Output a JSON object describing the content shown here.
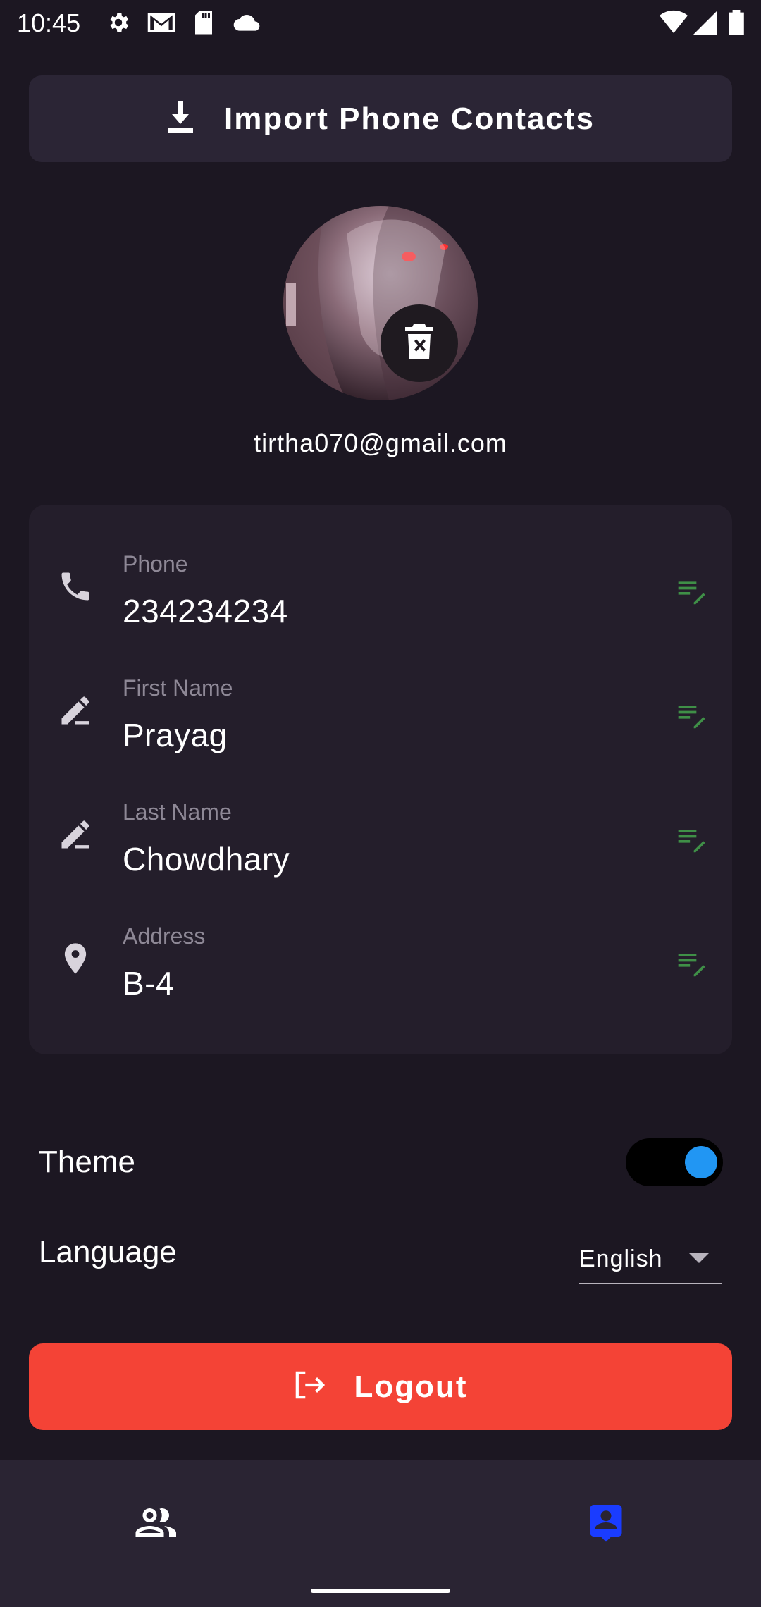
{
  "status_bar": {
    "time": "10:45",
    "left_icons": [
      "gear-icon",
      "gmail-icon",
      "sd-card-icon",
      "cloud-icon"
    ],
    "right_icons": [
      "wifi-icon",
      "signal-icon",
      "battery-icon"
    ]
  },
  "import_button": {
    "label": "Import Phone Contacts",
    "icon": "download-icon"
  },
  "profile": {
    "email": "tirtha070@gmail.com",
    "delete_icon": "delete-icon"
  },
  "fields": [
    {
      "label": "Phone",
      "value": "234234234",
      "icon": "phone-icon"
    },
    {
      "label": "First Name",
      "value": "Prayag",
      "icon": "edit-pencil-icon"
    },
    {
      "label": "Last Name",
      "value": "Chowdhary",
      "icon": "edit-pencil-icon"
    },
    {
      "label": "Address",
      "value": "B-4",
      "icon": "location-pin-icon"
    }
  ],
  "settings": {
    "theme_label": "Theme",
    "theme_on": true,
    "language_label": "Language",
    "language_value": "English"
  },
  "logout_button": {
    "label": "Logout",
    "icon": "logout-icon"
  },
  "bottom_nav": {
    "items": [
      "contacts-icon",
      "profile-icon"
    ],
    "active_index": 1
  },
  "colors": {
    "background": "#1c1722",
    "card": "#241e2b",
    "accent_blue": "#2196f3",
    "active_nav": "#1a3cff",
    "logout": "#f44336",
    "edit_icon": "#3f8f47"
  }
}
